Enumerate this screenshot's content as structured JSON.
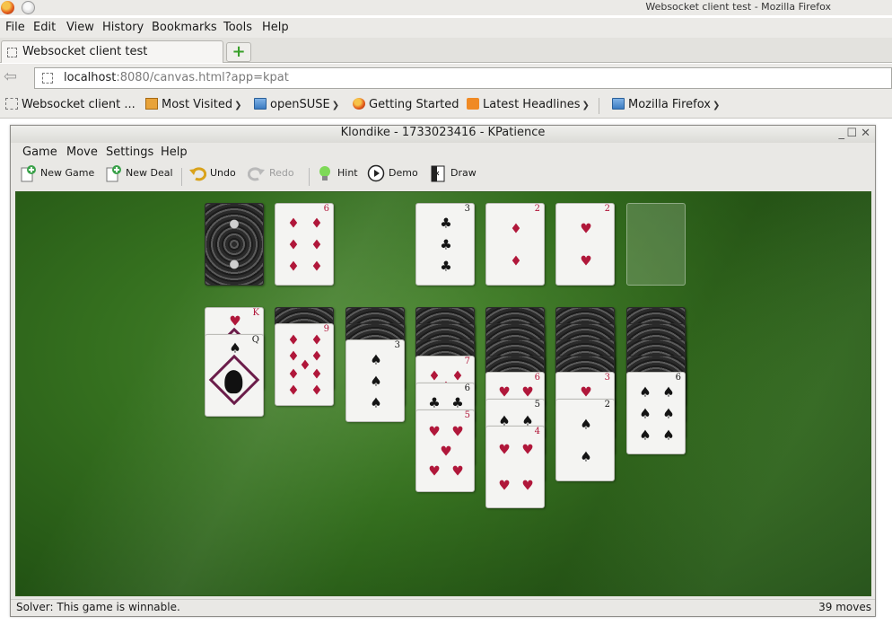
{
  "browser": {
    "window_title": "Websocket client test - Mozilla Firefox",
    "menu": [
      "File",
      "Edit",
      "View",
      "History",
      "Bookmarks",
      "Tools",
      "Help"
    ],
    "tab_title": "Websocket client test",
    "new_tab": "+",
    "url_host": "localhost",
    "url_rest": ":8080/canvas.html?app=kpat",
    "bookmarks": [
      "Websocket client ...",
      "Most Visited",
      "openSUSE",
      "Getting Started",
      "Latest Headlines",
      "Mozilla Firefox"
    ]
  },
  "kpat": {
    "title": "Klondike - 1733023416 - KPatience",
    "window_controls": [
      "_",
      "☐",
      "✕"
    ],
    "menu": [
      "Game",
      "Move",
      "Settings",
      "Help"
    ],
    "toolbar": {
      "new_game": "New Game",
      "new_deal": "New Deal",
      "undo": "Undo",
      "redo": "Redo",
      "hint": "Hint",
      "demo": "Demo",
      "draw": "Draw"
    },
    "status": "Solver: This game is winnable.",
    "moves": "39 moves"
  },
  "game": {
    "waste_top": {
      "rank": "6",
      "suit": "♦"
    },
    "foundations": [
      {
        "rank": "3",
        "suit": "♣"
      },
      {
        "rank": "2",
        "suit": "♦"
      },
      {
        "rank": "2",
        "suit": "♥"
      },
      {
        "rank": "",
        "suit": ""
      }
    ],
    "tableau": [
      {
        "hidden": 0,
        "cards": [
          {
            "rank": "K",
            "suit": "♥"
          },
          {
            "rank": "Q",
            "suit": "♠"
          }
        ]
      },
      {
        "hidden": 1,
        "cards": [
          {
            "rank": "9",
            "suit": "♦"
          }
        ]
      },
      {
        "hidden": 2,
        "cards": [
          {
            "rank": "3",
            "suit": "♠"
          }
        ]
      },
      {
        "hidden": 3,
        "cards": [
          {
            "rank": "7",
            "suit": "♦"
          },
          {
            "rank": "6",
            "suit": "♣"
          },
          {
            "rank": "5",
            "suit": "♥"
          }
        ]
      },
      {
        "hidden": 4,
        "cards": [
          {
            "rank": "6",
            "suit": "♥"
          },
          {
            "rank": "5",
            "suit": "♠"
          },
          {
            "rank": "4",
            "suit": "♥"
          }
        ]
      },
      {
        "hidden": 4,
        "cards": [
          {
            "rank": "3",
            "suit": "♥"
          },
          {
            "rank": "2",
            "suit": "♠"
          }
        ]
      },
      {
        "hidden": 4,
        "cards": [
          {
            "rank": "6",
            "suit": "♠"
          }
        ]
      }
    ]
  }
}
